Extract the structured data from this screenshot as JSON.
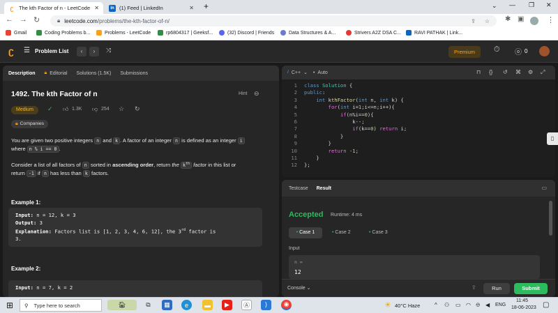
{
  "browser": {
    "tabs": [
      {
        "title": "The kth Factor of n - LeetCode"
      },
      {
        "title": "(1) Feed | LinkedIn"
      }
    ],
    "new_tab": "+",
    "url_host": "leetcode.com",
    "url_path": "/problems/the-kth-factor-of-n/",
    "bookmarks": [
      "Gmail",
      "Coding Problems b...",
      "Problems - LeetCode",
      "rp6804317 | Geeksf...",
      "(32) Discord | Friends",
      "Data Structures & A...",
      "Strivers A2Z DSA C...",
      "RAVI PATHAK | Link..."
    ]
  },
  "lc_nav": {
    "problem_list": "Problem List",
    "premium": "Premium",
    "streak": "0"
  },
  "left_tabs": [
    "Description",
    "Editorial",
    "Solutions (1.5K)",
    "Submissions"
  ],
  "problem": {
    "title": "1492. The kth Factor of n",
    "hint": "Hint",
    "difficulty": "Medium",
    "likes": "1.3K",
    "dislikes": "254",
    "companies": "Companies",
    "p1_a": "You are given two positive integers ",
    "p1_n": "n",
    "p1_b": " and ",
    "p1_k": "k",
    "p1_c": ". A factor of an integer ",
    "p1_n2": "n",
    "p1_d": " is defined as an integer ",
    "p1_i": "i",
    "p1_e": "where ",
    "p1_code": "n % i == 0",
    "p1_f": ".",
    "p2_a": "Consider a list of all factors of ",
    "p2_n": "n",
    "p2_b": " sorted in ",
    "p2_bold": "ascending order",
    "p2_c": ", return ",
    "p2_the": "the",
    "p2_kth": "k",
    "p2_th": "th",
    "p2_factor": "factor",
    "p2_d": " in this list or",
    "p2_e": "return ",
    "p2_m1": "-1",
    "p2_f": " if ",
    "p2_n2": "n",
    "p2_g": " has less than ",
    "p2_k2": "k",
    "p2_h": " factors.",
    "ex1_title": "Example 1:",
    "ex1_input_label": "Input:",
    "ex1_input": " n = 12, k = 3",
    "ex1_output_label": "Output:",
    "ex1_output": " 3",
    "ex1_expl_label": "Explanation:",
    "ex1_expl_a": " Factors list is [1, 2, 3, 4, 6, 12], the 3",
    "ex1_expl_sup": "rd",
    "ex1_expl_b": " factor is",
    "ex1_expl_c": "3.",
    "ex2_title": "Example 2:",
    "ex2_input_label": "Input:",
    "ex2_input": " n = 7, k = 2"
  },
  "editor": {
    "language": "C++",
    "mode": "Auto",
    "code_lines": [
      {
        "n": "1",
        "t": "class Solution {"
      },
      {
        "n": "2",
        "t": "public:"
      },
      {
        "n": "3",
        "t": "    int kthFactor(int n, int k) {"
      },
      {
        "n": "4",
        "t": "        for(int i=1;i<=n;i++){"
      },
      {
        "n": "5",
        "t": "            if(n%i==0){"
      },
      {
        "n": "6",
        "t": "                k--;"
      },
      {
        "n": "7",
        "t": "                if(k==0) return i;"
      },
      {
        "n": "8",
        "t": "            }"
      },
      {
        "n": "9",
        "t": "        }"
      },
      {
        "n": "10",
        "t": "        return -1;"
      },
      {
        "n": "11",
        "t": "    }"
      },
      {
        "n": "12",
        "t": "};"
      }
    ]
  },
  "result": {
    "tabs": [
      "Testcase",
      "Result"
    ],
    "status": "Accepted",
    "runtime": "Runtime: 4 ms",
    "cases": [
      "Case 1",
      "Case 2",
      "Case 3"
    ],
    "input_label": "Input",
    "var_label": "n =",
    "var_value": "12",
    "console": "Console",
    "run": "Run",
    "submit": "Submit"
  },
  "taskbar": {
    "search": "Type here to search",
    "weather": "40°C  Haze",
    "lang": "ENG",
    "time": "11:45",
    "date": "18-06-2023"
  },
  "colors": {
    "accepted": "#2cbb5d",
    "medium": "#ffb800",
    "premium": "#ffa116",
    "submit": "#2cbb5d"
  }
}
